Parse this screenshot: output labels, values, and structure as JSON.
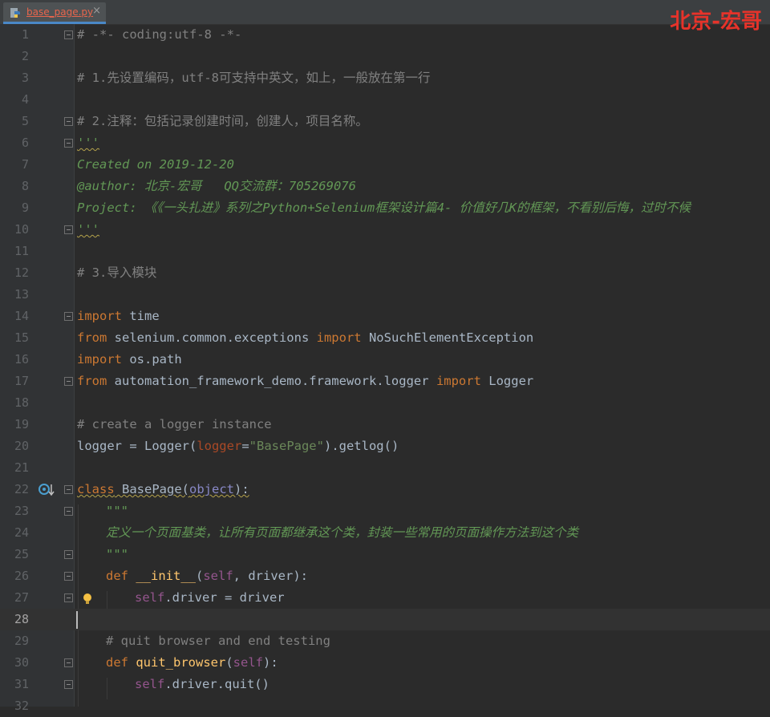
{
  "tab": {
    "filename": "base_page.py",
    "close_glyph": "×"
  },
  "watermark": "北京-宏哥",
  "colors": {
    "keyword": "#cc7832",
    "comment": "#808080",
    "docstring": "#629755",
    "string": "#6a8759",
    "self": "#94558d",
    "function": "#ffc66d",
    "background": "#2b2b2b",
    "gutter": "#313335",
    "watermark": "#e6332a"
  },
  "lines": {
    "l1": "# -*- coding:utf-8 -*-",
    "l3": "# 1.先设置编码，utf-8可支持中英文，如上，一般放在第一行",
    "l5": "# 2.注释：包括记录创建时间，创建人，项目名称。",
    "l6": "'''",
    "l7": "Created on 2019-12-20",
    "l8": "@author: 北京-宏哥   QQ交流群：705269076",
    "l9": "Project: 《《一头扎进》系列之Python+Selenium框架设计篇4- 价值好几K的框架，不看别后悔，过时不候",
    "l10": "'''",
    "l12": "# 3.导入模块",
    "l14": {
      "kw": "import",
      "rest": " time"
    },
    "l15": {
      "kw1": "from",
      "mod": " selenium.common.exceptions ",
      "kw2": "import",
      "rest": " NoSuchElementException"
    },
    "l16": {
      "kw": "import",
      "rest": " os.path"
    },
    "l17": {
      "kw1": "from",
      "mod": " automation_framework_demo.framework.logger ",
      "kw2": "import",
      "rest": " Logger"
    },
    "l19": "# create a logger instance",
    "l20": {
      "a": "logger = Logger(",
      "param": "logger",
      "eq": "=",
      "str": "\"BasePage\"",
      "b": ").getlog()"
    },
    "l22": {
      "kw": "class",
      "name": " BasePage",
      "p1": "(",
      "base": "object",
      "p2": "):"
    },
    "l23": "\"\"\"",
    "l24": "定义一个页面基类，让所有页面都继承这个类，封装一些常用的页面操作方法到这个类",
    "l25": "\"\"\"",
    "l26": {
      "kw": "def",
      "fn": " __init__",
      "p1": "(",
      "self": "self",
      "rest": ", driver):"
    },
    "l27": {
      "self": "self",
      "rest": ".driver = driver"
    },
    "l29": "# quit browser and end testing",
    "l30": {
      "kw": "def",
      "fn": " quit_browser",
      "p1": "(",
      "self": "self",
      "rest": "):"
    },
    "l31": {
      "self": "self",
      "rest": ".driver.quit()"
    }
  },
  "line_numbers": [
    "1",
    "2",
    "3",
    "4",
    "5",
    "6",
    "7",
    "8",
    "9",
    "10",
    "11",
    "12",
    "13",
    "14",
    "15",
    "16",
    "17",
    "18",
    "19",
    "20",
    "21",
    "22",
    "23",
    "24",
    "25",
    "26",
    "27",
    "28",
    "29",
    "30",
    "31",
    "32"
  ]
}
